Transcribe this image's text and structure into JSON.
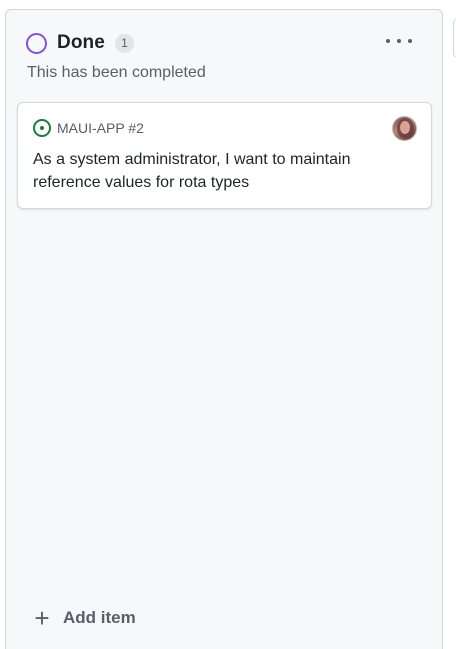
{
  "column": {
    "title": "Done",
    "count": "1",
    "description": "This has been completed",
    "status_color": "#8250df",
    "more_icon": "more-horizontal-icon"
  },
  "card": {
    "reference": "MAUI-APP #2",
    "title": "As a system administrator, I want to maintain reference values for rota types",
    "state_icon": "issue-opened-icon",
    "state_color": "#1a7f37",
    "avatar": "user-avatar"
  },
  "footer": {
    "add_item_icon": "plus-icon",
    "add_item_label": "Add item"
  }
}
